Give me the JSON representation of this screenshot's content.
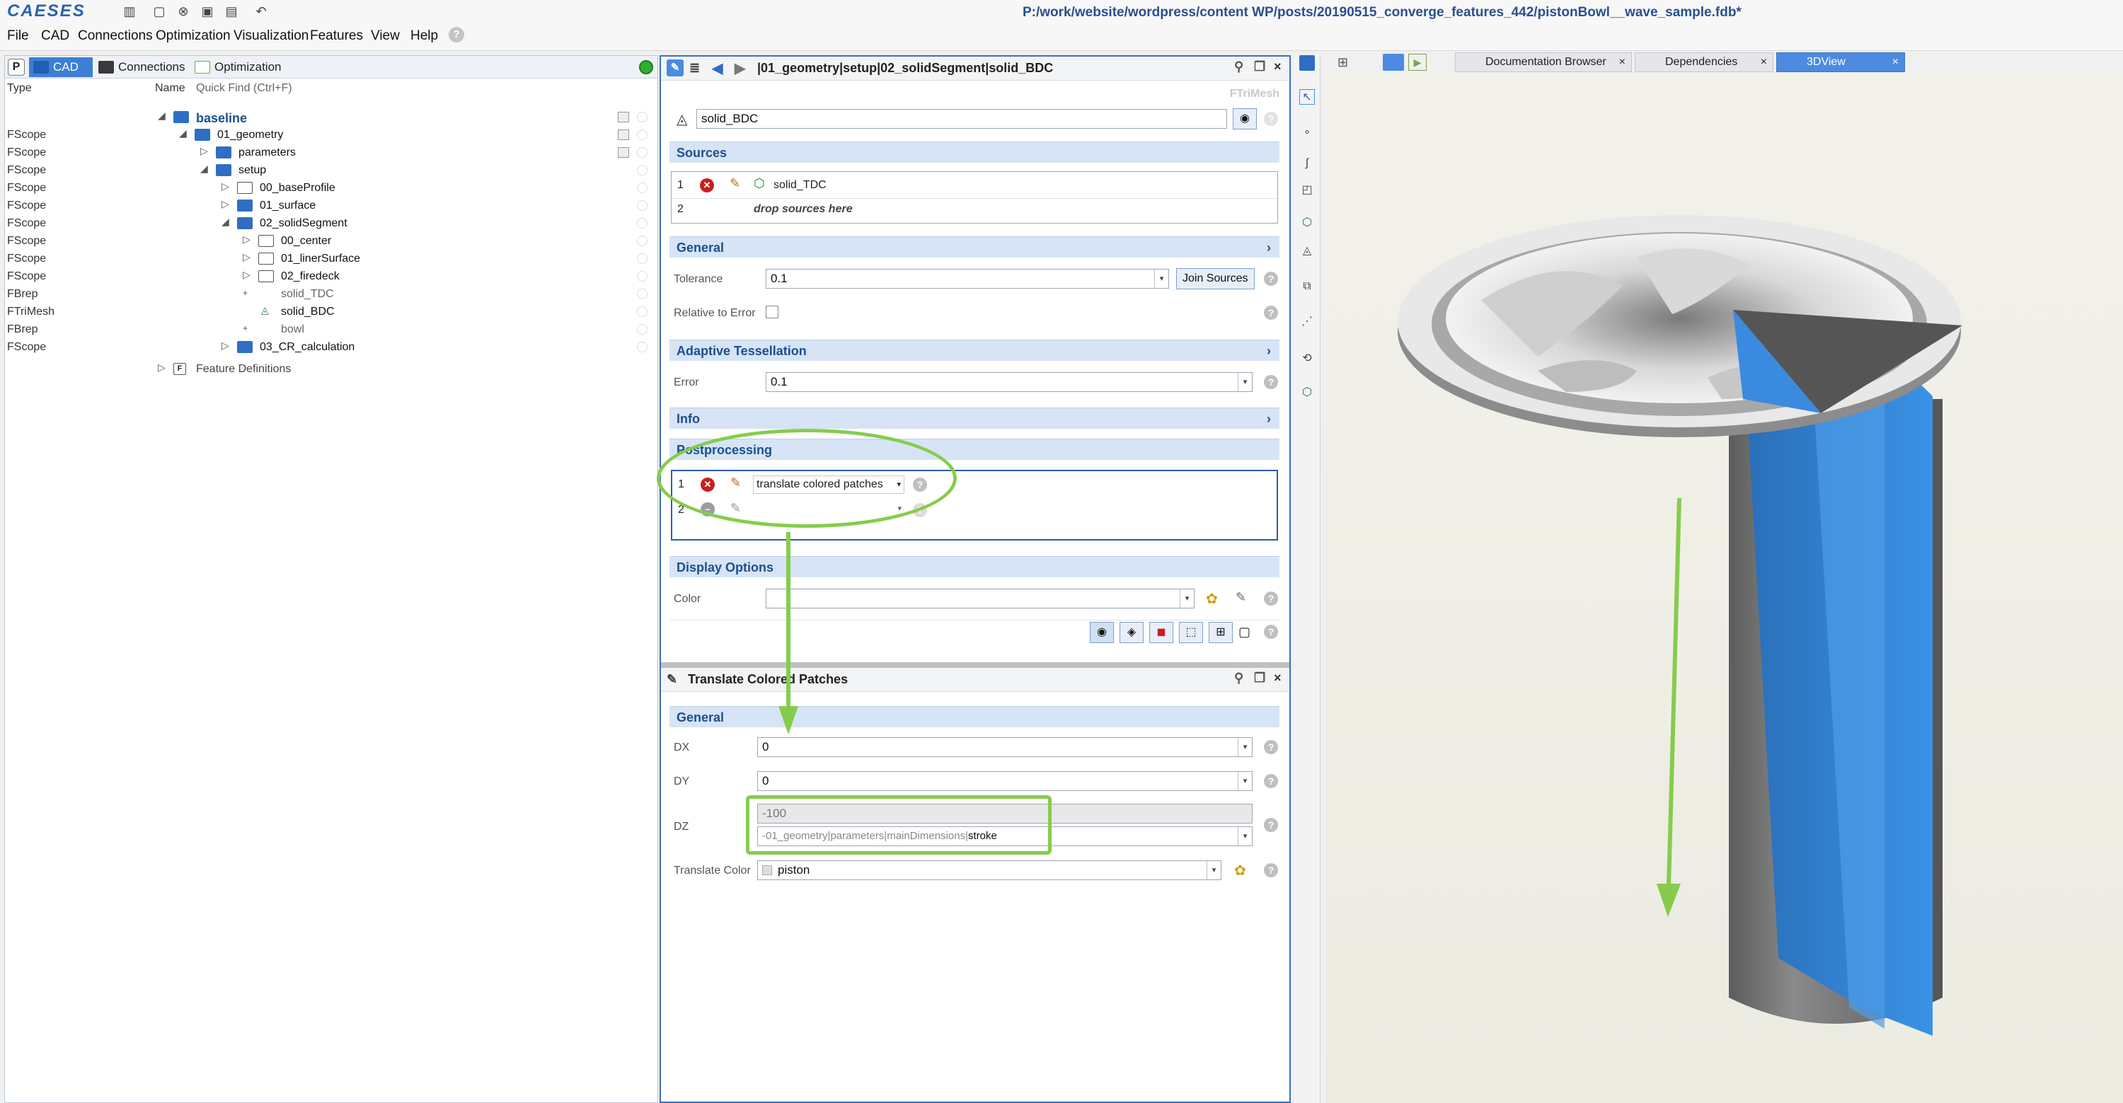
{
  "app": {
    "logo": "CAESES",
    "file_path": "P:/work/website/wordpress/content WP/posts/20190515_converge_features_442/pistonBowl__wave_sample.fdb*"
  },
  "menubar": [
    "File",
    "CAD",
    "Connections",
    "Optimization",
    "Visualization",
    "Features",
    "View",
    "Help"
  ],
  "left_panel": {
    "p_label": "P",
    "tabs": [
      "CAD",
      "Connections",
      "Optimization"
    ],
    "header": {
      "type": "Type",
      "name": "Name",
      "quick_find": "Quick Find (Ctrl+F)"
    },
    "tree": [
      {
        "type": "",
        "name": "baseline",
        "bold": true
      },
      {
        "type": "FScope",
        "name": "01_geometry"
      },
      {
        "type": "FScope",
        "name": "parameters"
      },
      {
        "type": "FScope",
        "name": "setup"
      },
      {
        "type": "FScope",
        "name": "00_baseProfile"
      },
      {
        "type": "FScope",
        "name": "01_surface"
      },
      {
        "type": "FScope",
        "name": "02_solidSegment"
      },
      {
        "type": "FScope",
        "name": "00_center"
      },
      {
        "type": "FScope",
        "name": "01_linerSurface"
      },
      {
        "type": "FScope",
        "name": "02_firedeck"
      },
      {
        "type": "FBrep",
        "name": "solid_TDC"
      },
      {
        "type": "FTriMesh",
        "name": "solid_BDC"
      },
      {
        "type": "FBrep",
        "name": "bowl"
      },
      {
        "type": "FScope",
        "name": "03_CR_calculation"
      },
      {
        "type": "",
        "name": "Feature Definitions"
      }
    ]
  },
  "object_editor": {
    "breadcrumb": "|01_geometry|setup|02_solidSegment|solid_BDC",
    "type_label": "FTriMesh",
    "name_value": "solid_BDC",
    "sources": {
      "title": "Sources",
      "rows": [
        {
          "index": "1",
          "value": "solid_TDC"
        },
        {
          "index": "2",
          "value": "drop sources here"
        }
      ]
    },
    "general": {
      "title": "General",
      "tolerance_label": "Tolerance",
      "tolerance_value": "0.1",
      "join_sources": "Join Sources",
      "relative_to_error": "Relative to Error"
    },
    "adaptive": {
      "title": "Adaptive Tessellation",
      "error_label": "Error",
      "error_value": "0.1"
    },
    "info": {
      "title": "Info"
    },
    "postprocessing": {
      "title": "Postprocessing",
      "rows": [
        {
          "index": "1",
          "value": "translate colored patches"
        },
        {
          "index": "2",
          "value": ""
        }
      ]
    },
    "display": {
      "title": "Display Options",
      "color_label": "Color"
    }
  },
  "translate_editor": {
    "title": "Translate Colored Patches",
    "general_title": "General",
    "dx_label": "DX",
    "dx_value": "0",
    "dy_label": "DY",
    "dy_value": "0",
    "dz_label": "DZ",
    "dz_result": "-100",
    "dz_expr_prefix": "-01_geometry|parameters|mainDimensions|",
    "dz_expr_suffix": "stroke",
    "color_label": "Translate Color",
    "color_value": "piston"
  },
  "right_tabs": [
    {
      "label": "Documentation Browser",
      "active": false
    },
    {
      "label": "Dependencies",
      "active": false
    },
    {
      "label": "3DView",
      "active": true
    }
  ],
  "colors": {
    "highlight": "#86cc4c",
    "accent": "#3c7fd4",
    "patch_blue": "#2f86dc",
    "section_bg": "#d6e4f5"
  }
}
